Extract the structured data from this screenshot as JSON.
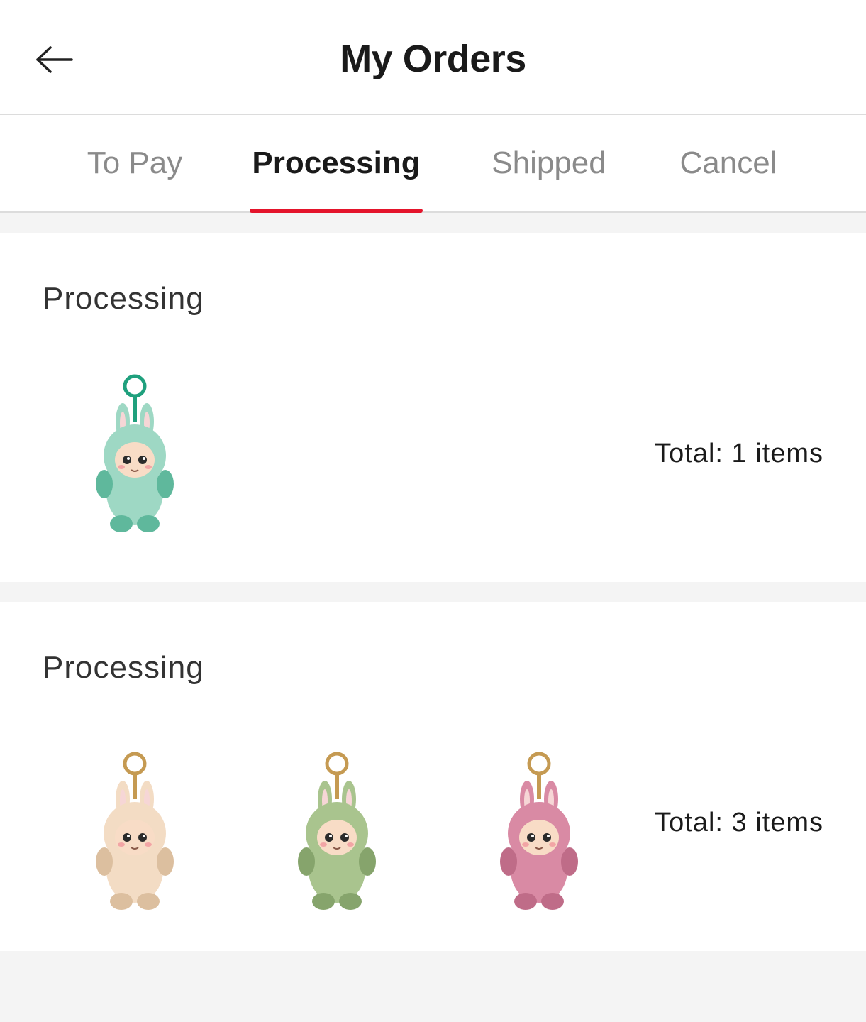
{
  "header": {
    "title": "My Orders",
    "back_icon": "arrow-left-icon"
  },
  "tabs": [
    {
      "label": "To Pay",
      "active": false
    },
    {
      "label": "Processing",
      "active": true
    },
    {
      "label": "Shipped",
      "active": false
    },
    {
      "label": "Cancel",
      "active": false
    }
  ],
  "colors": {
    "accent": "#e4142b",
    "background": "#f4f4f4",
    "card": "#ffffff"
  },
  "orders": [
    {
      "status": "Processing",
      "total": "Total: 1 items",
      "items": [
        {
          "name": "green-plush-keychain-image",
          "body": "#9ed8c4",
          "shade": "#5fb89c",
          "ring": "#1fa07d"
        }
      ]
    },
    {
      "status": "Processing",
      "total": "Total: 3 items",
      "items": [
        {
          "name": "cream-plush-keychain-image",
          "body": "#f3dcc4",
          "shade": "#dcbf9f",
          "ring": "#c59a52"
        },
        {
          "name": "green-plush-keychain-image",
          "body": "#a9c48e",
          "shade": "#86a46c",
          "ring": "#c59a52"
        },
        {
          "name": "pink-plush-keychain-image",
          "body": "#d98aa4",
          "shade": "#bf6c88",
          "ring": "#c59a52"
        }
      ]
    }
  ]
}
